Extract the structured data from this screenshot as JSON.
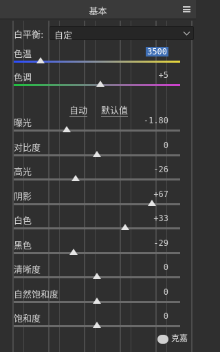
{
  "header": {
    "title": "基本"
  },
  "white_balance": {
    "label": "白平衡:",
    "value": "自定"
  },
  "temp": {
    "label": "色温",
    "value": "3500",
    "level": 0.16,
    "colors": [
      "#2b4cff",
      "#e8d83a"
    ]
  },
  "tint": {
    "label": "色调",
    "value": "+5",
    "level": 0.52,
    "colors": [
      "#20c040",
      "#d040d0"
    ]
  },
  "auto": {
    "auto_label": "自动",
    "default_label": "默认值"
  },
  "sliders": [
    {
      "label": "曝光",
      "value": "-1.80",
      "level": 0.32
    },
    {
      "label": "对比度",
      "value": "0",
      "level": 0.5
    },
    {
      "label": "高光",
      "value": "-26",
      "level": 0.37
    },
    {
      "label": "阴影",
      "value": "+67",
      "level": 0.83
    },
    {
      "label": "白色",
      "value": "+33",
      "level": 0.67
    },
    {
      "label": "黑色",
      "value": "-29",
      "level": 0.36
    },
    {
      "label": "清晰度",
      "value": "0",
      "level": 0.5
    },
    {
      "label": "自然饱和度",
      "value": "0",
      "level": 0.5
    },
    {
      "label": "饱和度",
      "value": "0",
      "level": 0.5
    }
  ],
  "watermark": {
    "text": "克嘉"
  }
}
